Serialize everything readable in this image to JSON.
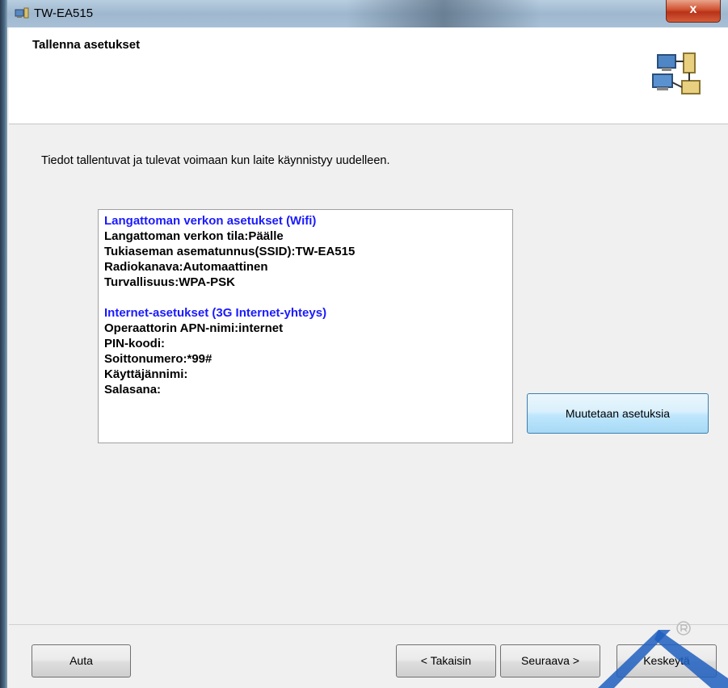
{
  "window": {
    "title": "TW-EA515",
    "close_label": "x"
  },
  "header": {
    "title": "Tallenna asetukset",
    "icon": "network-computers-icon"
  },
  "description": "Tiedot tallentuvat ja tulevat voimaan kun laite käynnistyy uudelleen.",
  "summary": {
    "wifi_heading": "Langattoman verkon asetukset (Wifi)",
    "wifi_lines": [
      "Langattoman verkon tila:Päälle",
      "Tukiaseman asematunnus(SSID):TW-EA515",
      "Radiokanava:Automaattinen",
      "Turvallisuus:WPA-PSK"
    ],
    "internet_heading": "Internet-asetukset  (3G Internet-yhteys)",
    "internet_lines": [
      "Operaattorin APN-nimi:internet",
      "PIN-koodi:",
      "Soittonumero:*99#",
      "Käyttäjännimi:",
      "Salasana:"
    ]
  },
  "buttons": {
    "change_settings": "Muutetaan asetuksia",
    "help": "Auta",
    "back": "< Takaisin",
    "next": "Seuraava >",
    "cancel": "Keskeytä"
  },
  "colors": {
    "heading_blue": "#1a1aff",
    "close_red": "#c8442a",
    "watermark_blue": "#1f5fbf"
  }
}
